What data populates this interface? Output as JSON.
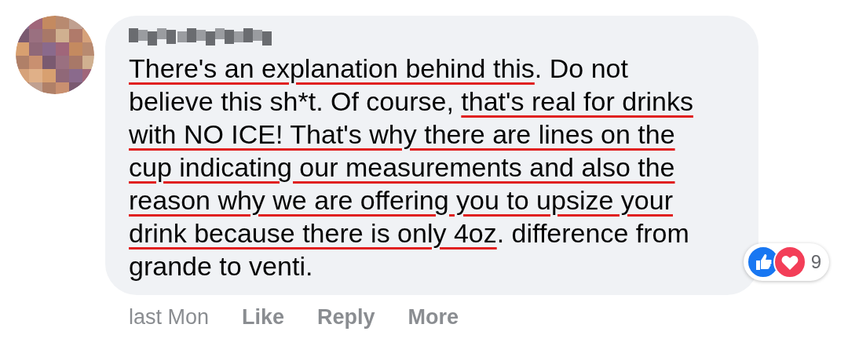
{
  "comment": {
    "author_redacted": true,
    "segments": [
      {
        "text": "There's an explanation behind this",
        "underlined": true
      },
      {
        "text": ". Do not believe this sh*t. Of course, ",
        "underlined": false
      },
      {
        "text": "that's real for drinks with NO ICE! That's why there are lines on the cup indicating our measurements and also the reason why we are offering you to upsize your drink because there is only 4oz",
        "underlined": true
      },
      {
        "text": ". difference from grande to venti.",
        "underlined": false
      }
    ],
    "reactions": {
      "count": "9"
    }
  },
  "actions": [
    {
      "label": "last Mon",
      "kind": "time"
    },
    {
      "label": "Like",
      "kind": "link"
    },
    {
      "label": "Reply",
      "kind": "link"
    },
    {
      "label": "More",
      "kind": "link"
    }
  ]
}
